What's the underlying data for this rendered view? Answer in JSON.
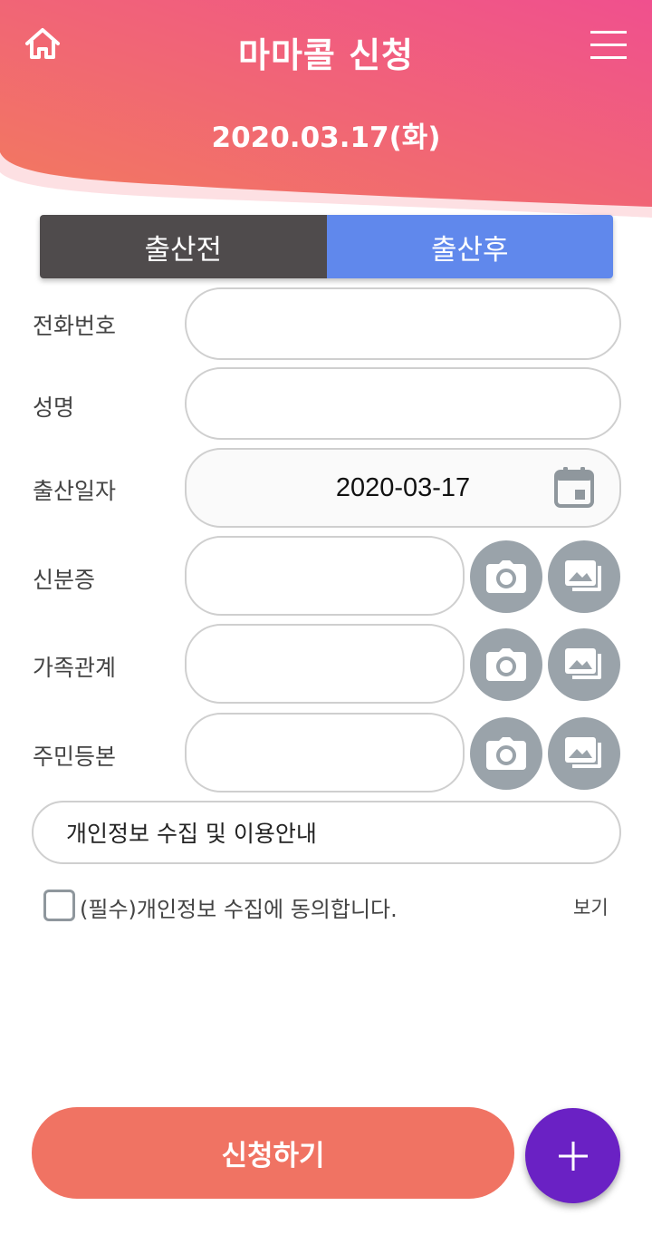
{
  "header": {
    "title": "마마콜 신청",
    "date": "2020.03.17(화)"
  },
  "tabs": [
    {
      "label": "출산전",
      "active": false
    },
    {
      "label": "출산후",
      "active": true
    }
  ],
  "form": {
    "phone": {
      "label": "전화번호",
      "value": ""
    },
    "name": {
      "label": "성명",
      "value": ""
    },
    "birth_date": {
      "label": "출산일자",
      "value": "2020-03-17"
    },
    "id_card": {
      "label": "신분증",
      "value": ""
    },
    "family": {
      "label": "가족관계",
      "value": ""
    },
    "resident": {
      "label": "주민등본",
      "value": ""
    }
  },
  "privacy": {
    "notice": "개인정보 수집 및 이용안내",
    "agree_text": "(필수)개인정보 수집에 동의합니다.",
    "view_link": "보기",
    "checked": false
  },
  "submit_label": "신청하기",
  "icons": {
    "home": "home-icon",
    "menu": "hamburger-menu-icon",
    "calendar": "calendar-icon",
    "camera": "camera-icon",
    "gallery": "gallery-icon",
    "plus": "plus-icon"
  },
  "colors": {
    "header_gradient_start": "#f27a5e",
    "header_gradient_end": "#f0508e",
    "tab_inactive": "#4f4b4c",
    "tab_active": "#6088ec",
    "submit": "#f07363",
    "fab": "#6a21c4",
    "icon_button": "#9aa3aa"
  }
}
